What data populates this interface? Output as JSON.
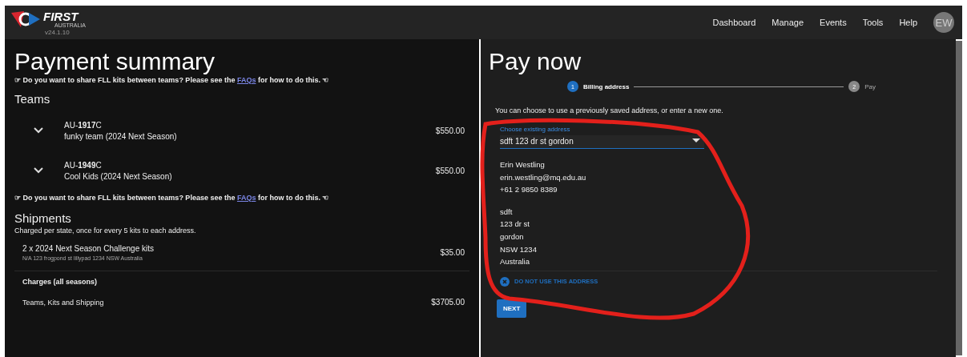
{
  "header": {
    "logo_text": "FIRST",
    "logo_sub": "AUSTRALIA",
    "version": "v24.1.10",
    "nav": [
      "Dashboard",
      "Manage",
      "Events",
      "Tools",
      "Help"
    ],
    "avatar": "EW"
  },
  "summary": {
    "title": "Payment summary",
    "note": {
      "hand_left": "☞",
      "before": "Do you want to share FLL kits between teams? Please see the",
      "link": "FAQs",
      "after": "for how to do this.",
      "hand_right": "☜"
    },
    "teams_heading": "Teams",
    "teams": [
      {
        "number": "AU-**1917**C",
        "name": "funky team (2024 Next Season)",
        "price": "$550.00",
        "expanded": false
      },
      {
        "number": "AU-**1949**C",
        "name": "Cool Kids (2024 Next Season)",
        "price": "$550.00",
        "expanded": false
      }
    ],
    "note2": {
      "hand_left": "☞",
      "before": "Do you want to share FLL kits between teams? Please see the",
      "link": "FAQs",
      "after": "for how to do this.",
      "hand_right": "☜"
    },
    "shipments_heading": "Shipments",
    "shipments_sub": "Charged per state, once for every 5 kits to each address.",
    "shipments": [
      {
        "title": "2 x 2024 Next Season Challenge kits",
        "address": "N/A 123 frogpond st lillypad 1234 NSW Australia",
        "price": "$35.00"
      }
    ],
    "charges_heading": "Charges (all seasons)",
    "charges": [
      {
        "label": "Teams, Kits and Shipping",
        "price": "$3705.00"
      }
    ]
  },
  "pay": {
    "title": "Pay now",
    "steps": [
      {
        "number": "1",
        "label": "Billing address",
        "selected": true
      },
      {
        "number": "2",
        "label": "Pay",
        "selected": false
      }
    ],
    "intro": "You can choose to use a previously saved address, or enter a new one.",
    "select": {
      "label": "Choose existing address",
      "value": "sdft 123 dr st gordon"
    },
    "contact": [
      "Erin Westling",
      "erin.westling@mq.edu.au",
      "+61 2 9850 8389"
    ],
    "address": [
      "sdft",
      "123 dr st",
      "gordon",
      "NSW 1234",
      "Australia"
    ],
    "clear_link": "DO NOT USE THIS ADDRESS",
    "next": "NEXT"
  }
}
